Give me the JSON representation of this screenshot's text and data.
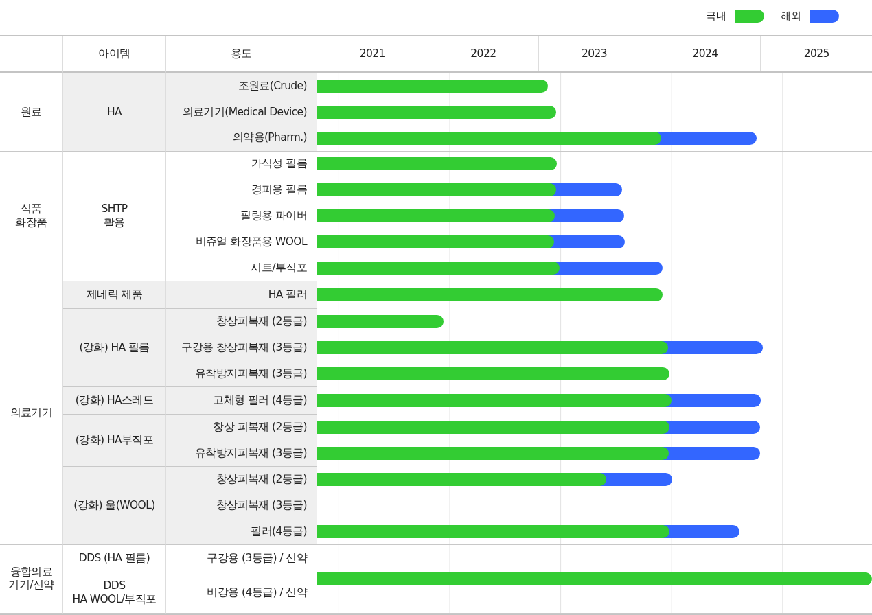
{
  "legend": [
    {
      "label": "국내",
      "kind": "domestic",
      "color": "#33cc33"
    },
    {
      "label": "해외",
      "kind": "overseas",
      "color": "#3366ff"
    }
  ],
  "columns": {
    "item": "아이템",
    "usage": "용도",
    "years": [
      "2021",
      "2022",
      "2023",
      "2024",
      "2025"
    ]
  },
  "categories": [
    {
      "label": "원료",
      "shaded": true,
      "items": [
        {
          "label": "HA",
          "uses": [
            {
              "label": "조원료(Crude)",
              "bar": {
                "domestic": {
                  "level": 0.416
                }
              }
            },
            {
              "label": "의료기기(Medical Device)",
              "bar": {
                "domestic": {
                  "level": 0.431
                }
              }
            },
            {
              "label": "의약용(Pharm.)",
              "bar": {
                "domestic": {
                  "level": 0.62
                },
                "overseas": {
                  "level": 0.792
                }
              }
            }
          ]
        }
      ]
    },
    {
      "label": "식품\n화장품",
      "shaded": false,
      "items": [
        {
          "label": "SHTP\n활용",
          "uses": [
            {
              "label": "가식성 필름",
              "bar": {
                "domestic": {
                  "level": 0.432
                }
              }
            },
            {
              "label": "경피용 필름",
              "bar": {
                "domestic": {
                  "level": 0.431
                },
                "overseas": {
                  "level": 0.55
                }
              }
            },
            {
              "label": "필링용 파이버",
              "bar": {
                "domestic": {
                  "level": 0.428
                },
                "overseas": {
                  "level": 0.553
                }
              }
            },
            {
              "label": "비쥬얼 화장품용 WOOL",
              "bar": {
                "domestic": {
                  "level": 0.427
                },
                "overseas": {
                  "level": 0.554
                }
              }
            },
            {
              "label": "시트/부직포",
              "bar": {
                "domestic": {
                  "level": 0.437
                },
                "overseas": {
                  "level": 0.623
                }
              }
            }
          ]
        }
      ]
    },
    {
      "label": "의료기기",
      "shaded": true,
      "items": [
        {
          "label": "제네릭 제품",
          "uses": [
            {
              "label": "HA 필러",
              "bar": {
                "domestic": {
                  "level": 0.623
                }
              }
            }
          ]
        },
        {
          "label": "(강화) HA  필름",
          "uses": [
            {
              "label": "창상피복재 (2등급)",
              "bar": {
                "domestic": {
                  "level": 0.228
                }
              }
            },
            {
              "label": "구강용 창상피복재 (3등급)",
              "bar": {
                "domestic": {
                  "level": 0.632
                },
                "overseas": {
                  "level": 0.803
                }
              }
            },
            {
              "label": "유착방지피복재 (3등급)",
              "bar": {
                "domestic": {
                  "level": 0.635
                }
              }
            }
          ]
        },
        {
          "label": "(강화) HA스레드",
          "uses": [
            {
              "label": "고체형 필러 (4등급)",
              "bar": {
                "domestic": {
                  "level": 0.639
                },
                "overseas": {
                  "level": 0.8
                }
              }
            }
          ]
        },
        {
          "label": "(강화) HA부직포",
          "uses": [
            {
              "label": "창상 피복재 (2등급)",
              "bar": {
                "domestic": {
                  "level": 0.635
                },
                "overseas": {
                  "level": 0.798
                }
              }
            },
            {
              "label": "유착방지피복재 (3등급)",
              "bar": {
                "domestic": {
                  "level": 0.634
                },
                "overseas": {
                  "level": 0.798
                }
              }
            }
          ]
        },
        {
          "label": "(강화) 울(WOOL)",
          "uses": [
            {
              "label": "창상피복재 (2등급)",
              "bar": {
                "domestic": {
                  "level": 0.521
                },
                "overseas": {
                  "level": 0.64
                }
              }
            },
            {
              "label": "창상피복재 (3등급)"
            },
            {
              "label": "필러(4등급)",
              "bar": {
                "domestic": {
                  "level": 0.635
                },
                "overseas": {
                  "level": 0.761
                }
              }
            }
          ]
        }
      ]
    },
    {
      "label": "융합의료\n기기/신약",
      "shaded": false,
      "bar": {
        "domestic": {
          "level": 1.0
        }
      },
      "items": [
        {
          "label": "DDS (HA 필름)",
          "uses": [
            {
              "label": "구강용 (3등급) / 신약"
            }
          ]
        },
        {
          "label": "DDS\nHA WOOL/부직포",
          "uses": [
            {
              "label": "비강용 (4등급) / 신약"
            }
          ]
        }
      ]
    }
  ]
}
